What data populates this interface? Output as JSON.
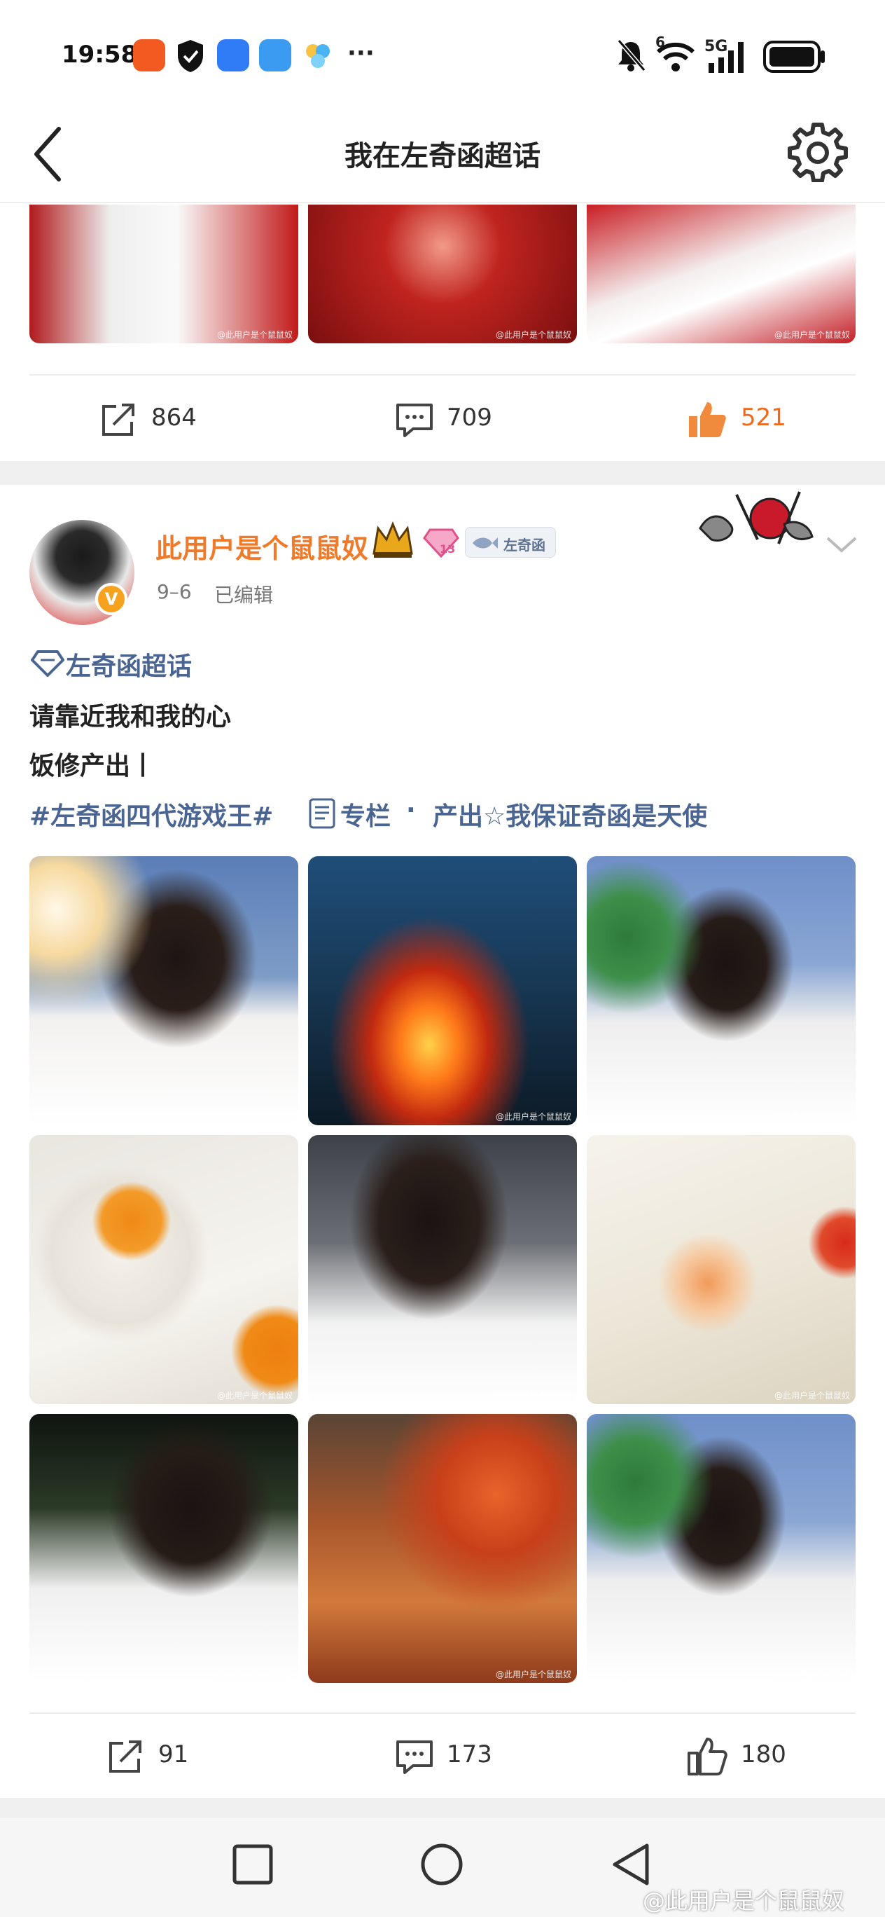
{
  "status_bar": {
    "time": "19:58",
    "signal_label": "5G",
    "wifi_label": "6"
  },
  "header": {
    "title": "我在左奇函超话"
  },
  "previous_post": {
    "actions": {
      "repost": "864",
      "comment": "709",
      "like": "521"
    }
  },
  "post": {
    "user_name": "此用户是个鼠鼠奴",
    "level_badge": "13",
    "fan_badge": "左奇函",
    "time": "9–6",
    "edited": "已编辑",
    "supertopic": "左奇函超话",
    "lines": [
      "请靠近我和我的心",
      "饭修产出丨"
    ],
    "hashtag": "#左奇函四代游戏王#",
    "column_label": "专栏",
    "separator": "·",
    "column_title": "产出☆我保证奇函是天使",
    "actions": {
      "repost": "91",
      "comment": "173",
      "like": "180"
    }
  },
  "watermark": "@此用户是个鼠鼠奴",
  "image_watermark": "@此用户是个鼠鼠奴",
  "colors": {
    "accent": "#ee6a1e",
    "topic_blue": "#4a6591",
    "username_orange": "#ee7a2a"
  }
}
